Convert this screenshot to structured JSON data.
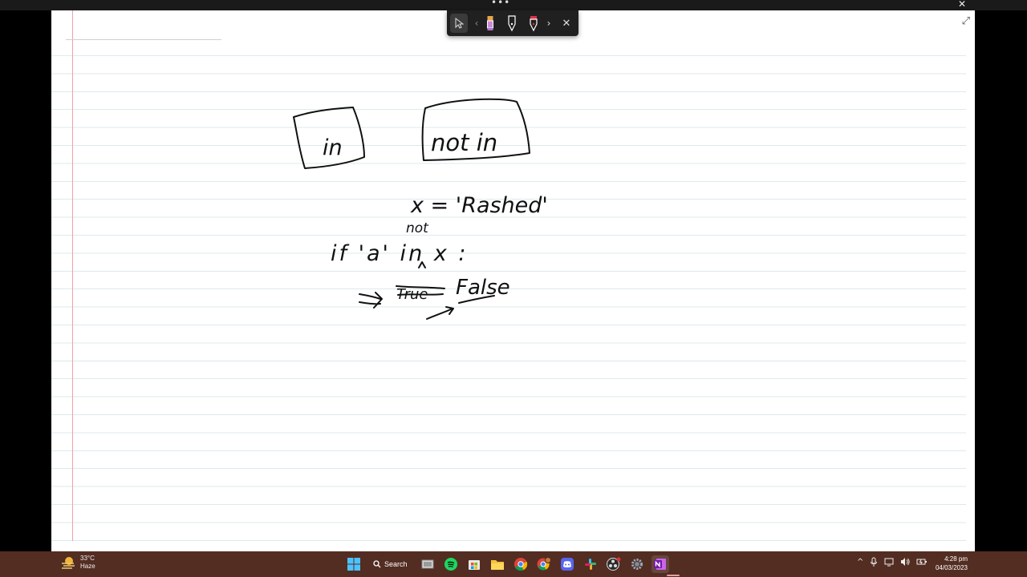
{
  "window": {
    "more_glyph": "•••",
    "close_glyph": "✕",
    "expand_glyph": "⤢"
  },
  "ink_toolbar": {
    "close_glyph": "✕",
    "prev_glyph": "‹",
    "next_glyph": "›",
    "pens": [
      {
        "name": "highlighter",
        "color": "#c98bd8"
      },
      {
        "name": "pen-black",
        "color": "#ffffff"
      },
      {
        "name": "pen-red",
        "color": "#e0304a"
      }
    ]
  },
  "notes": {
    "box1": "in",
    "box2": "not in",
    "line1": "x = 'Rashed'",
    "insert_word": "not",
    "line2": "if 'a' in x :",
    "arrow": "=>",
    "struck": "True",
    "result": "False"
  },
  "taskbar": {
    "weather_temp": "33°C",
    "weather_desc": "Haze",
    "search_label": "Search",
    "time": "4:28 pm",
    "date": "04/03/2023",
    "tray_chevron": "^"
  },
  "colors": {
    "taskbar": "#532d22",
    "page": "#ffffff",
    "rule": "#dceaee",
    "margin": "#f0a0a8"
  }
}
